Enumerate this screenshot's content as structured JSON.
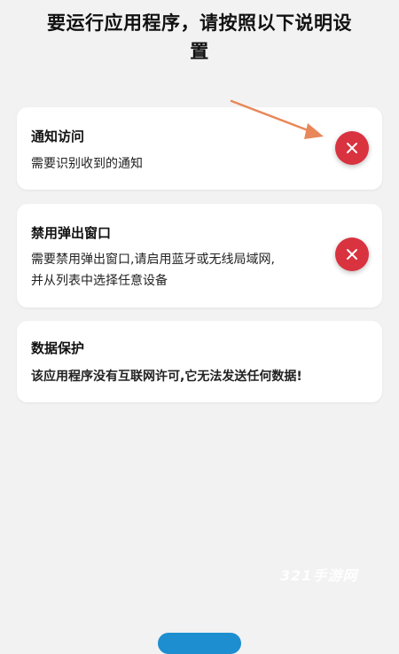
{
  "header": {
    "title_line1": "要运行应用程序，请按照以下说明设",
    "title_line2": "置"
  },
  "cards": [
    {
      "title": "通知访问",
      "desc_lines": [
        "需要识别收到的通知"
      ],
      "status": "disabled",
      "status_icon": "close-icon"
    },
    {
      "title": "禁用弹出窗口",
      "desc_lines": [
        "需要禁用弹出窗口,请启用蓝牙或无线局域网,",
        "并从列表中选择任意设备"
      ],
      "status": "disabled",
      "status_icon": "close-icon"
    },
    {
      "title": "数据保护",
      "desc_lines": [
        "该应用程序没有互联网许可,它无法发送任何数据!"
      ]
    }
  ],
  "watermark": "321手游网",
  "colors": {
    "status_disabled": "#d8333f",
    "arrow": "#e8885a",
    "card_bg": "#ffffff",
    "page_bg": "#f2f2f2",
    "bottom_button": "#1d8fd1"
  }
}
